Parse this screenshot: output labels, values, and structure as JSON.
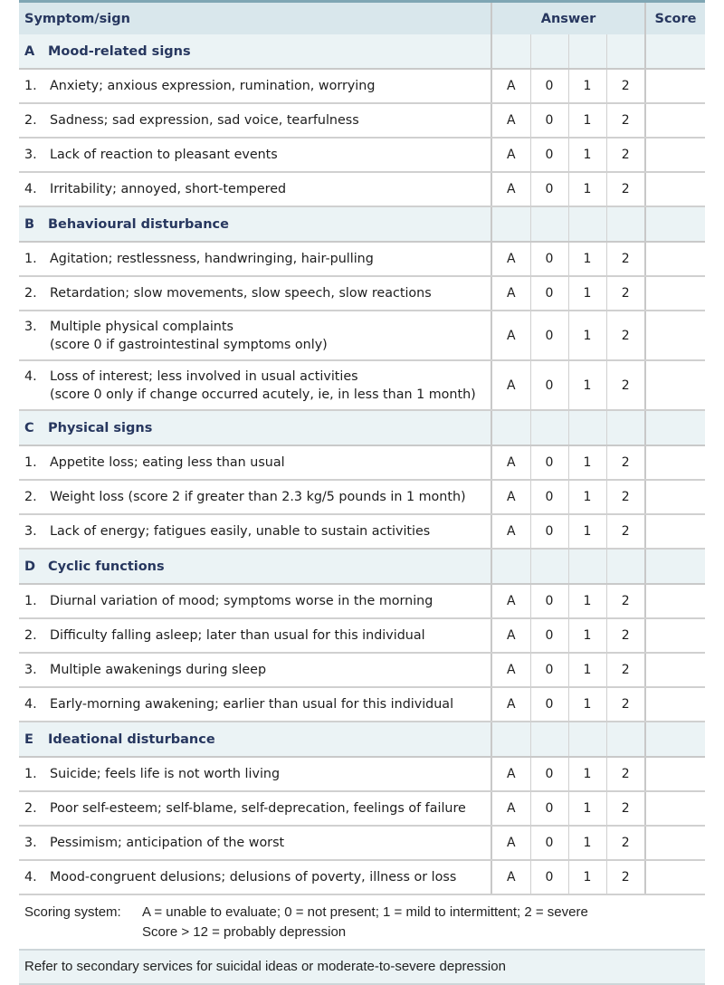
{
  "header": {
    "symptom_label": "Symptom/sign",
    "answer_label": "Answer",
    "score_label": "Score"
  },
  "answer_options": [
    "A",
    "0",
    "1",
    "2"
  ],
  "sections": [
    {
      "letter": "A",
      "title": "Mood-related signs",
      "items": [
        {
          "num": "1.",
          "lines": [
            "Anxiety; anxious expression, rumination, worrying"
          ]
        },
        {
          "num": "2.",
          "lines": [
            "Sadness; sad expression, sad voice, tearfulness"
          ]
        },
        {
          "num": "3.",
          "lines": [
            "Lack of reaction to pleasant events"
          ]
        },
        {
          "num": "4.",
          "lines": [
            "Irritability; annoyed, short-tempered"
          ]
        }
      ]
    },
    {
      "letter": "B",
      "title": "Behavioural disturbance",
      "items": [
        {
          "num": "1.",
          "lines": [
            "Agitation; restlessness, handwringing, hair-pulling"
          ]
        },
        {
          "num": "2.",
          "lines": [
            "Retardation; slow movements, slow speech, slow reactions"
          ]
        },
        {
          "num": "3.",
          "lines": [
            "Multiple physical complaints",
            "(score 0 if gastrointestinal symptoms only)"
          ]
        },
        {
          "num": "4.",
          "lines": [
            "Loss of interest; less involved in usual activities",
            "(score 0 only if change occurred acutely, ie, in less than 1 month)"
          ]
        }
      ]
    },
    {
      "letter": "C",
      "title": "Physical signs",
      "items": [
        {
          "num": "1.",
          "lines": [
            "Appetite loss; eating less than usual"
          ]
        },
        {
          "num": "2.",
          "lines": [
            "Weight loss (score 2 if greater than 2.3 kg/5 pounds in 1 month)"
          ]
        },
        {
          "num": "3.",
          "lines": [
            "Lack of energy; fatigues easily, unable to sustain activities"
          ]
        }
      ]
    },
    {
      "letter": "D",
      "title": "Cyclic functions",
      "items": [
        {
          "num": "1.",
          "lines": [
            "Diurnal variation of mood; symptoms worse in the morning"
          ]
        },
        {
          "num": "2.",
          "lines": [
            "Difficulty falling asleep; later than usual for this individual"
          ]
        },
        {
          "num": "3.",
          "lines": [
            "Multiple awakenings during sleep"
          ]
        },
        {
          "num": "4.",
          "lines": [
            "Early-morning awakening; earlier than usual for this individual"
          ]
        }
      ]
    },
    {
      "letter": "E",
      "title": "Ideational disturbance",
      "items": [
        {
          "num": "1.",
          "lines": [
            "Suicide; feels life is not worth living"
          ]
        },
        {
          "num": "2.",
          "lines": [
            "Poor self-esteem; self-blame, self-deprecation, feelings of failure"
          ]
        },
        {
          "num": "3.",
          "lines": [
            "Pessimism; anticipation of the worst"
          ]
        },
        {
          "num": "4.",
          "lines": [
            "Mood-congruent delusions; delusions of poverty, illness or loss"
          ]
        }
      ]
    }
  ],
  "scoring": {
    "label": "Scoring system:",
    "lines": [
      "A = unable to evaluate; 0 = not present; 1 = mild to intermittent; 2 = severe",
      "Score > 12 = probably depression"
    ]
  },
  "referral_note": "Refer to secondary services for suicidal ideas or moderate-to-severe depression",
  "colors": {
    "header_bg": "#d9e7ec",
    "header_top_border": "#7fa6b4",
    "section_bg": "#ebf3f5",
    "heading_text": "#27375f"
  }
}
